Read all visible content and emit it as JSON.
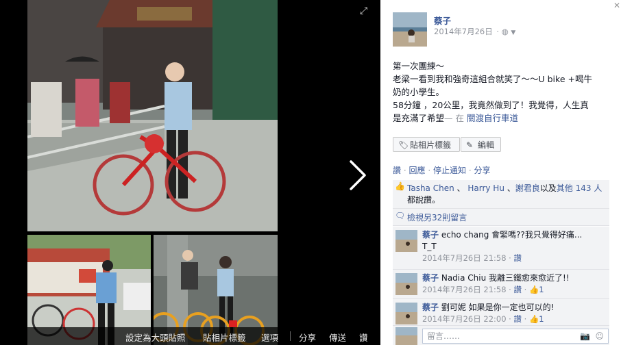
{
  "viewer": {
    "expand_icon": "expand-icon",
    "next_icon": "chevron-right-icon",
    "bottom_bar": [
      "設定為大頭貼照",
      "貼相片標籤",
      "選項",
      "分享",
      "傳送",
      "讚"
    ]
  },
  "post": {
    "author": "蔡子",
    "date": "2014年7月26日",
    "privacy_icon": "globe-icon",
    "lines": [
      "第一次團練～",
      "老梁一看到我和強奇這組合就笑了～～U bike +喝牛",
      "奶的小學生。",
      "58分鐘 ，20公里，我竟然做到了！我覺得，人生真"
    ],
    "last_line": "是充滿了希望",
    "location_sep": "— 在",
    "location": "關渡自行車道"
  },
  "buttons": {
    "tag_photo": "貼相片標籤",
    "edit": "編輯"
  },
  "actions": [
    "讚",
    "回應",
    "停止通知",
    "分享"
  ],
  "likes": {
    "names": [
      "Tasha Chen",
      "Harry Hu",
      "謝君良"
    ],
    "others": "其他 143 人",
    "and": "以及",
    "suffix": "都說讚。"
  },
  "view_more": "檢視另32則留言",
  "comments": [
    {
      "name": "蔡子",
      "text": "echo chang 會緊嗎??我只覺得好痛...",
      "text2": "T_T",
      "time": "2014年7月26日 21:58",
      "like": "讚",
      "likes": ""
    },
    {
      "name": "蔡子",
      "text": "Nadia Chiu 我離三鐵愈來愈近了!!",
      "text2": "",
      "time": "2014年7月26日 21:58",
      "like": "讚",
      "likes": "1"
    },
    {
      "name": "蔡子",
      "text": "劉可妮 如果是你一定也可以的!",
      "text2": "",
      "time": "2014年7月26日 22:00",
      "like": "讚",
      "likes": "1"
    }
  ],
  "composer": {
    "placeholder": "留言……"
  },
  "colors": {
    "link": "#3b5998",
    "meta": "#90949c",
    "panel_bg": "#f2f3f5"
  }
}
